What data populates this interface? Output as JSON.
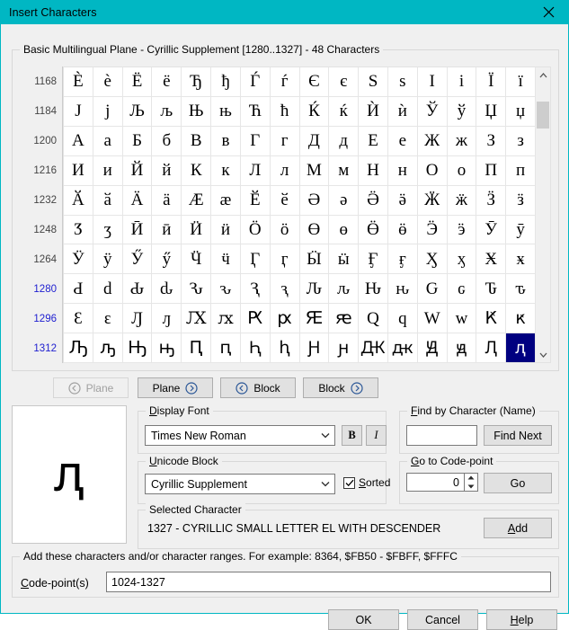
{
  "window": {
    "title": "Insert Characters",
    "close_icon": "close-icon",
    "titlebar_color": "#00b7c3"
  },
  "grid_panel": {
    "legend": "Basic Multilingual Plane - Cyrillic Supplement [1280..1327] - 48 Characters",
    "row_labels": [
      "1168",
      "1184",
      "1200",
      "1216",
      "1232",
      "1248",
      "1264",
      "1280",
      "1296",
      "1312"
    ],
    "in_block_rows": [
      "1280",
      "1296",
      "1312"
    ],
    "in_block_label_color": "#2020d0",
    "selection_color": "#000080",
    "rows": [
      [
        "Ѐ",
        "ѐ",
        "Ё",
        "ё",
        "Ђ",
        "ђ",
        "Ѓ",
        "ѓ",
        "Є",
        "є",
        "Ѕ",
        "ѕ",
        "І",
        "і",
        "Ї",
        "ї"
      ],
      [
        "Ј",
        "ј",
        "Љ",
        "љ",
        "Њ",
        "њ",
        "Ћ",
        "ћ",
        "Ќ",
        "ќ",
        "Ѝ",
        "ѝ",
        "Ў",
        "ў",
        "Џ",
        "џ"
      ],
      [
        "А",
        "а",
        "Б",
        "б",
        "В",
        "в",
        "Г",
        "г",
        "Д",
        "д",
        "Е",
        "е",
        "Ж",
        "ж",
        "З",
        "з"
      ],
      [
        "И",
        "и",
        "Й",
        "й",
        "К",
        "к",
        "Л",
        "л",
        "М",
        "м",
        "Н",
        "н",
        "О",
        "о",
        "П",
        "п"
      ],
      [
        "Ӑ",
        "ӑ",
        "Ӓ",
        "ӓ",
        "Ӕ",
        "ӕ",
        "Ӗ",
        "ӗ",
        "Ә",
        "ә",
        "Ӛ",
        "ӛ",
        "Ӝ",
        "ӝ",
        "Ӟ",
        "ӟ"
      ],
      [
        "Ӡ",
        "ӡ",
        "Ӣ",
        "ӣ",
        "Ӥ",
        "ӥ",
        "Ӧ",
        "ӧ",
        "Ө",
        "ө",
        "Ӫ",
        "ӫ",
        "Ӭ",
        "ӭ",
        "Ӯ",
        "ӯ"
      ],
      [
        "Ӱ",
        "ӱ",
        "Ӳ",
        "ӳ",
        "Ӵ",
        "ӵ",
        "Ӷ",
        "ӷ",
        "Ӹ",
        "ӹ",
        "Ӻ",
        "ӻ",
        "Ӽ",
        "ӽ",
        "Ӿ",
        "ӿ"
      ],
      [
        "Ԁ",
        "ԁ",
        "Ԃ",
        "ԃ",
        "Ԅ",
        "ԅ",
        "Ԇ",
        "ԇ",
        "Ԉ",
        "ԉ",
        "Ԋ",
        "ԋ",
        "Ԍ",
        "ԍ",
        "Ԏ",
        "ԏ"
      ],
      [
        "Ԑ",
        "ԑ",
        "Ԓ",
        "ԓ",
        "Ԕ",
        "ԕ",
        "Ԗ",
        "ԗ",
        "Ԙ",
        "ԙ",
        "Ԛ",
        "ԛ",
        "Ԝ",
        "ԝ",
        "Ԟ",
        "ԟ"
      ],
      [
        "Ԡ",
        "ԡ",
        "Ԣ",
        "ԣ",
        "Ԥ",
        "ԥ",
        "Ԧ",
        "ԧ",
        "Ԩ",
        "ԩ",
        "Ԫ",
        "ԫ",
        "Ԭ",
        "ԭ",
        "Ԯ",
        "ԯ"
      ]
    ],
    "selected_row_index": 9,
    "selected_col_index": 15,
    "scrollbar": {
      "up_icon": "chevron-up-icon",
      "down_icon": "chevron-down-icon",
      "thumb": "scroll-thumb"
    }
  },
  "nav": {
    "prev_plane": "Plane",
    "next_plane": "Plane",
    "prev_block": "Block",
    "next_block": "Block",
    "prev_plane_disabled": true
  },
  "preview": {
    "glyph": "ԯ"
  },
  "display_font": {
    "legend": "Display Font",
    "value": "Times New Roman",
    "bold_label": "B",
    "italic_label": "I",
    "dropdown_icon": "chevron-down-icon"
  },
  "unicode_block": {
    "legend": "Unicode Block",
    "value": "Cyrillic Supplement",
    "sorted_label": "Sorted",
    "sorted_checked": true,
    "check_icon": "check-icon",
    "dropdown_icon": "chevron-down-icon"
  },
  "find_by_character": {
    "legend": "Find by Character (Name)",
    "value": "",
    "button_label": "Find Next"
  },
  "goto_codepoint": {
    "legend": "Go to Code-point",
    "value": "0",
    "button_label": "Go",
    "spin_up_icon": "spin-up-icon",
    "spin_down_icon": "spin-down-icon"
  },
  "selected_character": {
    "legend": "Selected Character",
    "description": "1327 - CYRILLIC SMALL LETTER EL WITH DESCENDER",
    "add_label": "Add"
  },
  "codepoints": {
    "legend": "Add these characters and/or character ranges. For example: 8364, $FB50 - $FBFF, $FFFC",
    "label": "Code-point(s)",
    "value": "1024-1327"
  },
  "dialog_buttons": {
    "ok": "OK",
    "cancel": "Cancel",
    "help": "Help"
  }
}
